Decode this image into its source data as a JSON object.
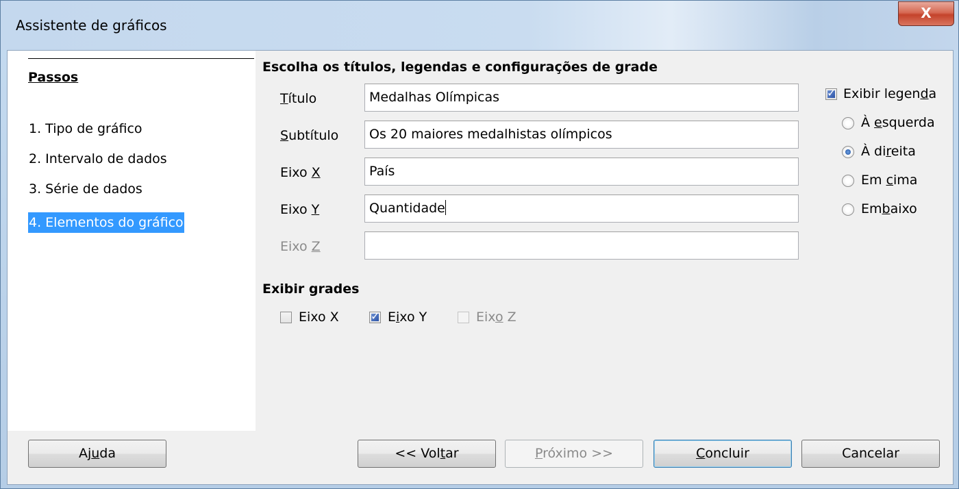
{
  "window": {
    "title": "Assistente de gráficos",
    "close_label": "X"
  },
  "steps": {
    "heading": "Passos",
    "items": [
      {
        "label": "1. Tipo de gráfico",
        "active": false
      },
      {
        "label": "2. Intervalo de dados",
        "active": false
      },
      {
        "label": "3. Série de dados",
        "active": false
      },
      {
        "label": "4. Elementos do gráfico",
        "active": true
      }
    ]
  },
  "titles_section": {
    "heading": "Escolha os títulos, legendas e configurações de grade",
    "fields": {
      "titulo": {
        "label": "Título",
        "value": "Medalhas Olímpicas"
      },
      "subtitulo": {
        "label": "Subtítulo",
        "value": "Os 20 maiores medalhistas olímpicos"
      },
      "eixo_x": {
        "label": "Eixo X",
        "value": "País"
      },
      "eixo_y": {
        "label": "Eixo Y",
        "value": "Quantidade"
      },
      "eixo_z": {
        "label": "Eixo Z",
        "value": ""
      }
    }
  },
  "legend": {
    "show_label": "Exibir legenda",
    "show_checked": true,
    "positions": [
      {
        "label": "À esquerda",
        "selected": false
      },
      {
        "label": "À direita",
        "selected": true
      },
      {
        "label": "Em cima",
        "selected": false
      },
      {
        "label": "Embaixo",
        "selected": false
      }
    ]
  },
  "grids": {
    "heading": "Exibir grades",
    "x": {
      "label": "Eixo X",
      "checked": false
    },
    "y": {
      "label": "Eixo Y",
      "checked": true
    },
    "z": {
      "label": "Eixo Z",
      "checked": false,
      "disabled": true
    }
  },
  "buttons": {
    "help": "Ajuda",
    "back": "<< Voltar",
    "next": "Próximo >>",
    "finish": "Concluir",
    "cancel": "Cancelar"
  }
}
